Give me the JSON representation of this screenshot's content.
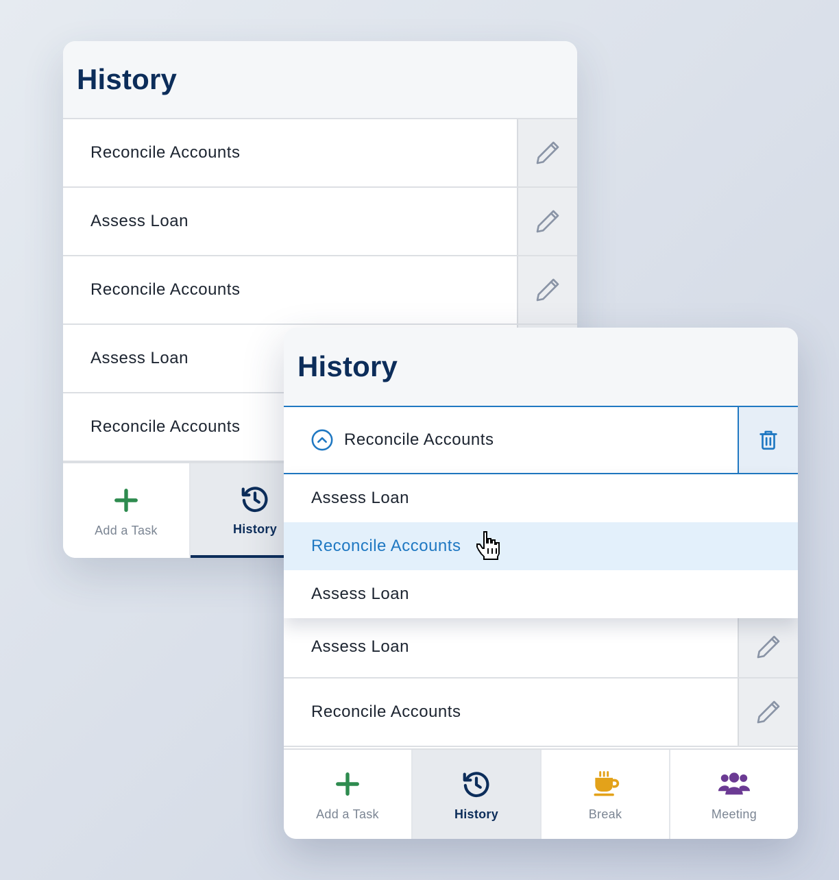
{
  "back_panel": {
    "title": "History",
    "rows": [
      {
        "label": "Reconcile Accounts",
        "action_icon": "pencil-icon"
      },
      {
        "label": "Assess Loan",
        "action_icon": "pencil-icon"
      },
      {
        "label": "Reconcile Accounts",
        "action_icon": "pencil-icon"
      },
      {
        "label": "Assess Loan",
        "action_icon": "pencil-icon"
      },
      {
        "label": "Reconcile Accounts",
        "action_icon": "pencil-icon"
      }
    ],
    "tabs": [
      {
        "label": "Add a Task",
        "icon": "plus-icon",
        "active": false
      },
      {
        "label": "History",
        "icon": "history-icon",
        "active": true
      }
    ]
  },
  "front_panel": {
    "title": "History",
    "dropdown": {
      "selected": "Reconcile Accounts",
      "expand_icon": "chevron-up-circle-icon",
      "action_icon": "trash-icon",
      "options": [
        {
          "label": "Assess Loan",
          "highlighted": false
        },
        {
          "label": "Reconcile Accounts",
          "highlighted": true
        },
        {
          "label": "Assess Loan",
          "highlighted": false
        }
      ]
    },
    "rows": [
      {
        "label": "Assess Loan",
        "action_icon": "pencil-icon"
      },
      {
        "label": "Reconcile Accounts",
        "action_icon": "pencil-icon"
      }
    ],
    "tabs": [
      {
        "label": "Add a Task",
        "icon": "plus-icon",
        "active": false
      },
      {
        "label": "History",
        "icon": "history-icon",
        "active": true
      },
      {
        "label": "Break",
        "icon": "coffee-icon",
        "active": false
      },
      {
        "label": "Meeting",
        "icon": "people-icon",
        "active": false
      }
    ]
  },
  "colors": {
    "title": "#0c2d5a",
    "accent_blue": "#1f78c2",
    "add_green": "#2e8b4f",
    "break_orange": "#e3a21a",
    "meeting_purple": "#6b3a93",
    "pencil_gray": "#8a94a6"
  }
}
